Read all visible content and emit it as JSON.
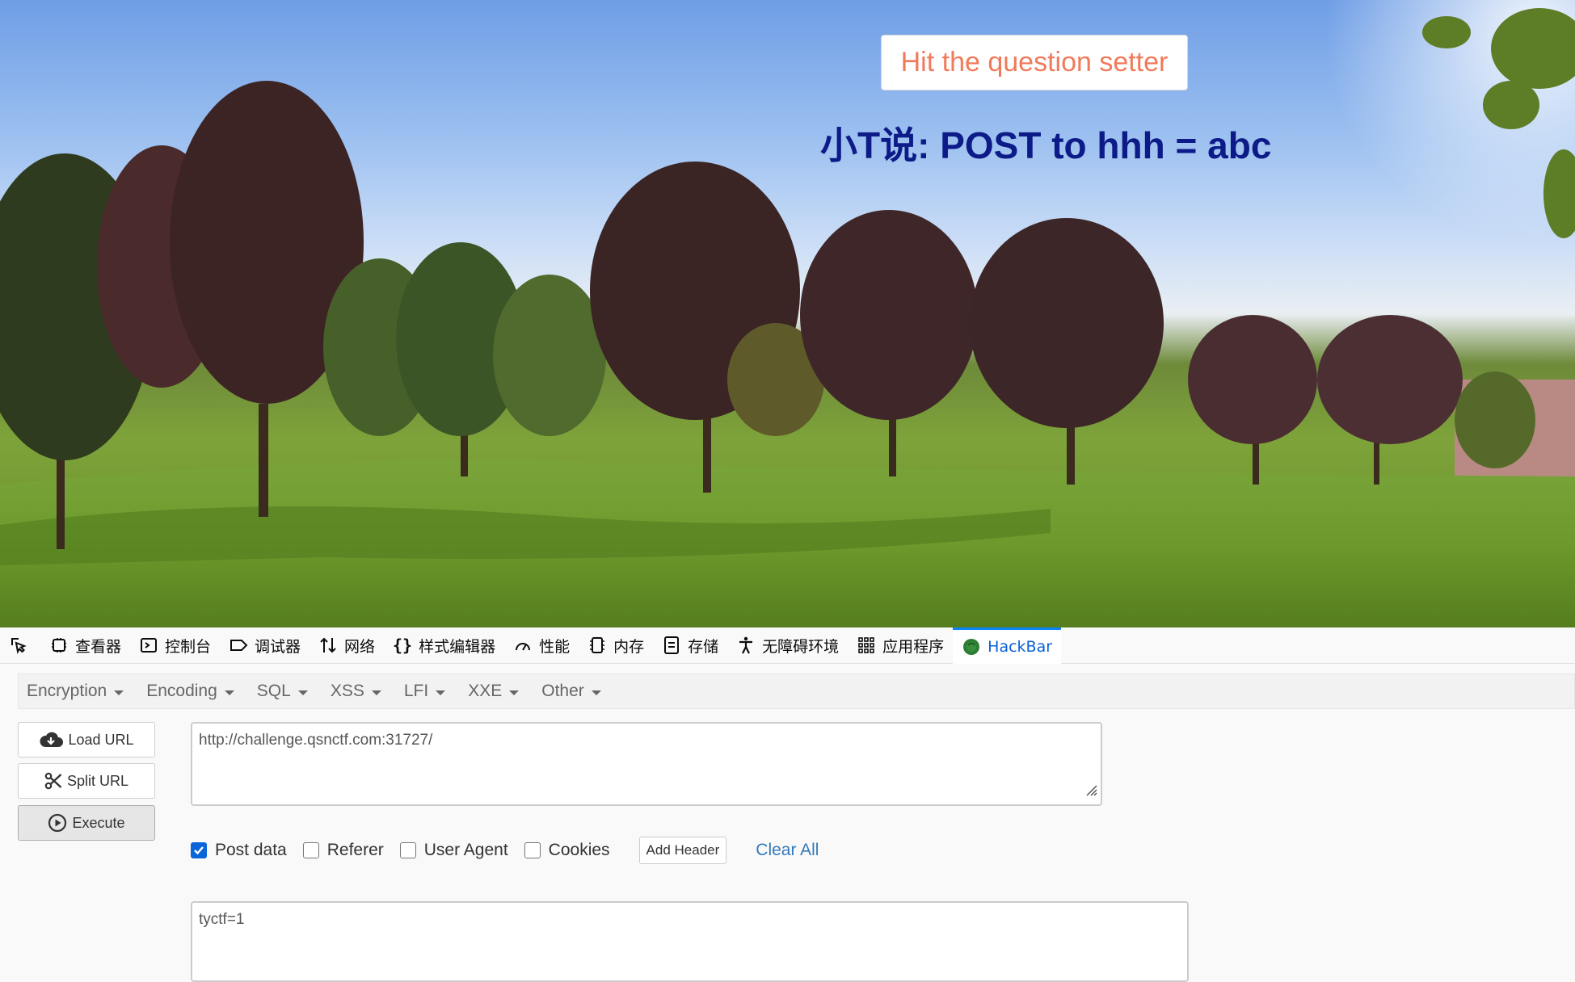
{
  "webpage": {
    "button_label": "Hit the question setter",
    "hint_text": "小T说: POST to hhh = abc"
  },
  "devtools": {
    "tabs": [
      {
        "label": "查看器",
        "icon": "inspector-icon"
      },
      {
        "label": "控制台",
        "icon": "console-icon"
      },
      {
        "label": "调试器",
        "icon": "debugger-icon"
      },
      {
        "label": "网络",
        "icon": "network-icon"
      },
      {
        "label": "样式编辑器",
        "icon": "style-editor-icon"
      },
      {
        "label": "性能",
        "icon": "performance-icon"
      },
      {
        "label": "内存",
        "icon": "memory-icon"
      },
      {
        "label": "存储",
        "icon": "storage-icon"
      },
      {
        "label": "无障碍环境",
        "icon": "accessibility-icon"
      },
      {
        "label": "应用程序",
        "icon": "application-icon"
      },
      {
        "label": "HackBar",
        "icon": "hackbar-icon"
      }
    ],
    "active_tab": "HackBar"
  },
  "hackbar": {
    "menu": [
      "Encryption",
      "Encoding",
      "SQL",
      "XSS",
      "LFI",
      "XXE",
      "Other"
    ],
    "load_url": "Load URL",
    "split_url": "Split URL",
    "execute": "Execute",
    "url_value": "http://challenge.qsnctf.com:31727/",
    "options": {
      "post_data": {
        "label": "Post data",
        "checked": true
      },
      "referer": {
        "label": "Referer",
        "checked": false
      },
      "user_agent": {
        "label": "User Agent",
        "checked": false
      },
      "cookies": {
        "label": "Cookies",
        "checked": false
      }
    },
    "add_header": "Add Header",
    "clear_all": "Clear All",
    "post_body": "tyctf=1"
  },
  "colors": {
    "accent": "#0a84ff",
    "hint_text": "#0d1b88",
    "button_text": "#f07a5a",
    "link": "#337ab7"
  }
}
